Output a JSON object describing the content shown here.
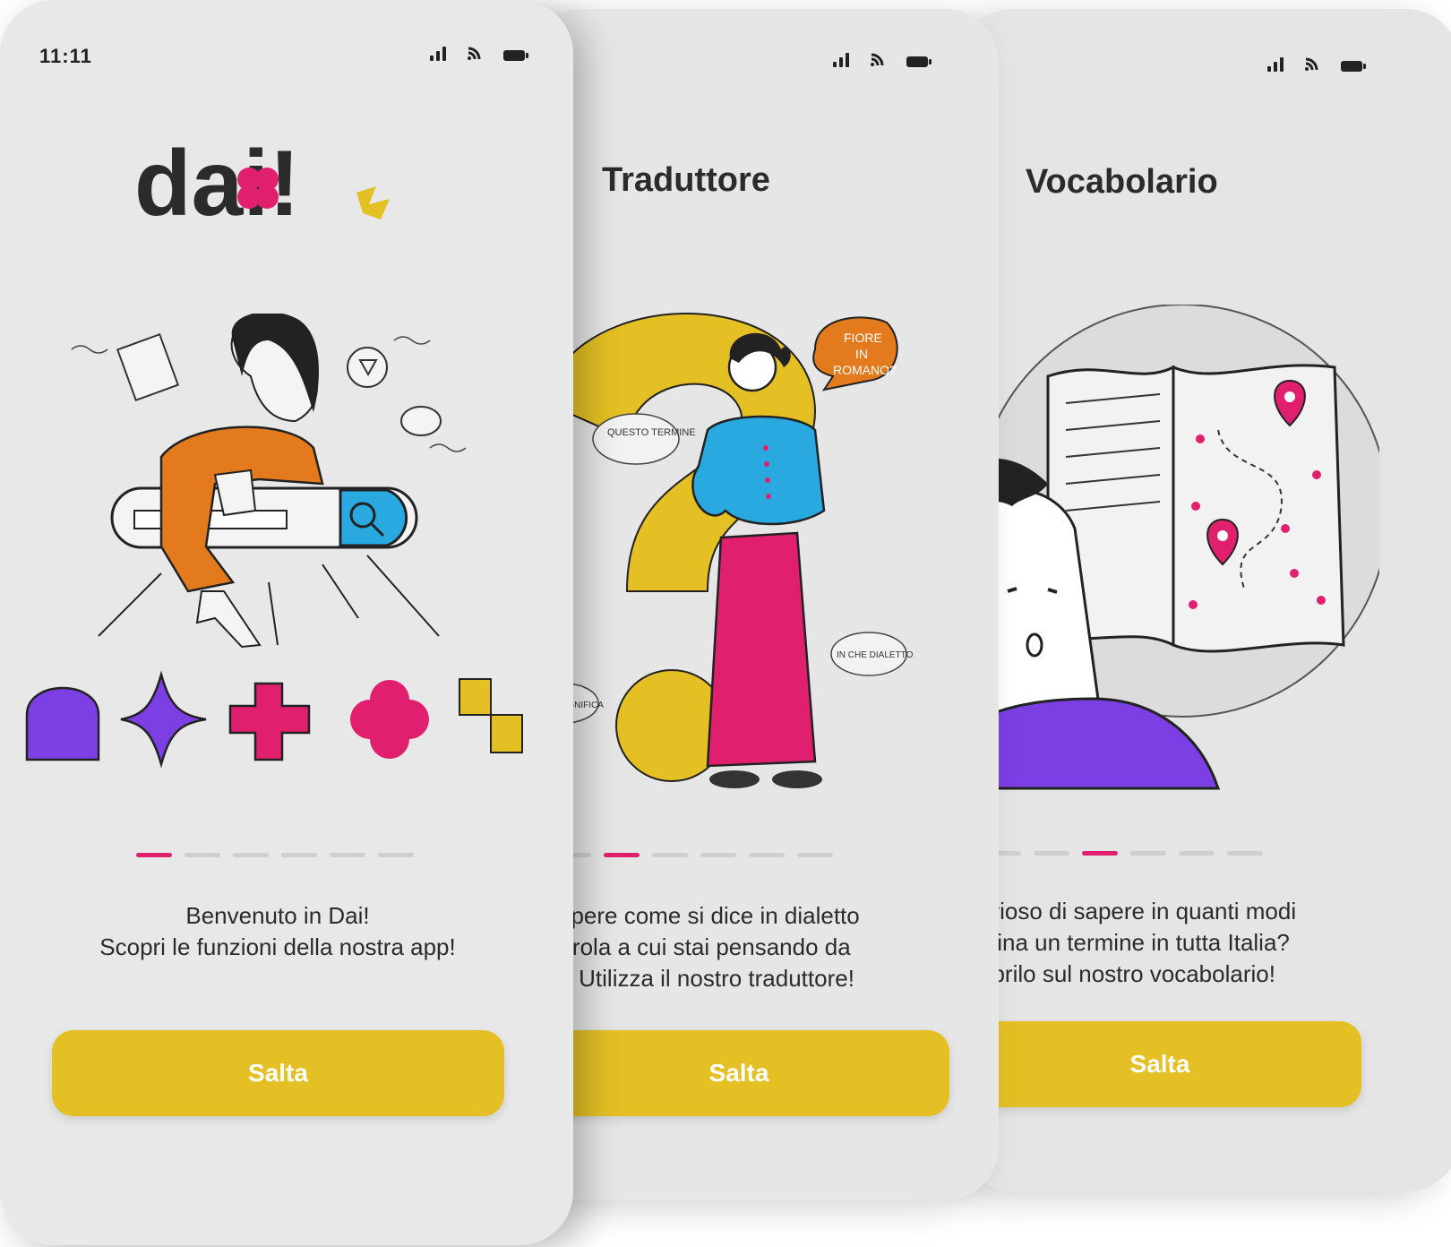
{
  "screens": [
    {
      "status_time": "11:11",
      "logo": "dai!",
      "description": [
        "Benvenuto in Dai!",
        "Scopri le funzioni della nostra app!"
      ],
      "active_step": 1,
      "steps_total": 6,
      "button": "Salta"
    },
    {
      "title": "Traduttore",
      "speech_bubble": [
        "FIORE",
        "IN",
        "ROMANO?"
      ],
      "thought_bubbles": [
        "QUESTO TERMINE",
        "IN CHE DIALETTO",
        "CHE SIGNIFICA"
      ],
      "description": [
        "sapere come si dice in dialetto",
        "parola a cui stai pensando da",
        "o? Utilizza il nostro traduttore!"
      ],
      "active_step": 2,
      "steps_total": 6,
      "button": "Salta"
    },
    {
      "title": "Vocabolario",
      "description": [
        "curioso di sapere in quanti modi",
        "eclina un termine in tutta Italia?",
        "coprilo sul nostro vocabolario!"
      ],
      "active_step": 3,
      "steps_total": 6,
      "button": "Salta"
    }
  ],
  "colors": {
    "accent_pink": "#e0206e",
    "accent_yellow": "#e4c024",
    "accent_purple": "#7b3fe4",
    "accent_blue": "#2aa8e0",
    "accent_orange": "#e47a1e"
  },
  "icons": [
    "signal-icon",
    "wifi-icon",
    "battery-icon",
    "search-icon"
  ]
}
